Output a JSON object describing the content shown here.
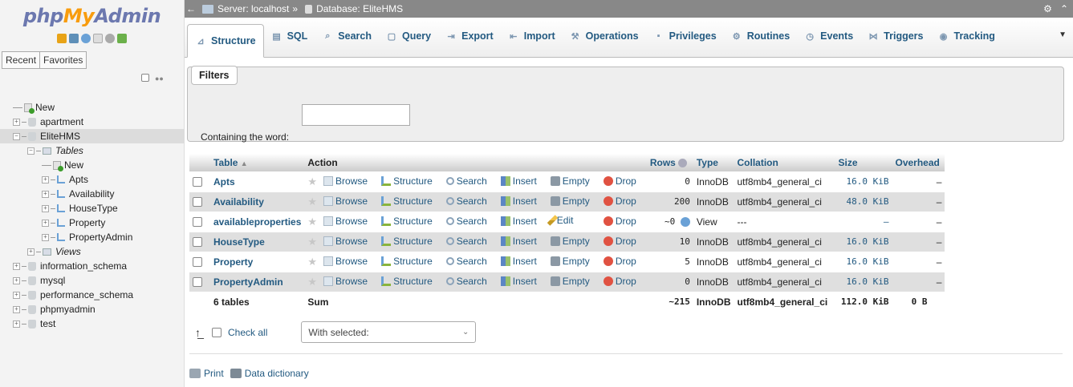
{
  "sidebar": {
    "logo": {
      "php": "php",
      "my": "My",
      "admin": "Admin"
    },
    "recent_label": "Recent",
    "favorites_label": "Favorites",
    "tree": [
      {
        "label": "New",
        "level": 0,
        "kind": "new"
      },
      {
        "label": "apartment",
        "level": 0,
        "kind": "db"
      },
      {
        "label": "EliteHMS",
        "level": 0,
        "kind": "db",
        "selected": true
      },
      {
        "label": "Tables",
        "level": 1,
        "kind": "folder",
        "italic": true
      },
      {
        "label": "New",
        "level": 2,
        "kind": "new"
      },
      {
        "label": "Apts",
        "level": 2,
        "kind": "table"
      },
      {
        "label": "Availability",
        "level": 2,
        "kind": "table"
      },
      {
        "label": "HouseType",
        "level": 2,
        "kind": "table"
      },
      {
        "label": "Property",
        "level": 2,
        "kind": "table"
      },
      {
        "label": "PropertyAdmin",
        "level": 2,
        "kind": "table"
      },
      {
        "label": "Views",
        "level": 1,
        "kind": "folder",
        "italic": true
      },
      {
        "label": "information_schema",
        "level": 0,
        "kind": "db"
      },
      {
        "label": "mysql",
        "level": 0,
        "kind": "db"
      },
      {
        "label": "performance_schema",
        "level": 0,
        "kind": "db"
      },
      {
        "label": "phpmyadmin",
        "level": 0,
        "kind": "db"
      },
      {
        "label": "test",
        "level": 0,
        "kind": "db"
      }
    ]
  },
  "topbar": {
    "server": "Server: localhost",
    "separator": "»",
    "database": "Database: EliteHMS"
  },
  "tabs": [
    {
      "label": "Structure",
      "icon": "structure-icon",
      "active": true
    },
    {
      "label": "SQL",
      "icon": "sql-icon"
    },
    {
      "label": "Search",
      "icon": "search-icon"
    },
    {
      "label": "Query",
      "icon": "query-icon"
    },
    {
      "label": "Export",
      "icon": "export-icon"
    },
    {
      "label": "Import",
      "icon": "import-icon"
    },
    {
      "label": "Operations",
      "icon": "operations-icon"
    },
    {
      "label": "Privileges",
      "icon": "privileges-icon"
    },
    {
      "label": "Routines",
      "icon": "routines-icon"
    },
    {
      "label": "Events",
      "icon": "events-icon"
    },
    {
      "label": "Triggers",
      "icon": "triggers-icon"
    },
    {
      "label": "Tracking",
      "icon": "tracking-icon"
    }
  ],
  "filters": {
    "legend": "Filters",
    "label": "Containing the word:",
    "value": ""
  },
  "table": {
    "headers": {
      "table": "Table",
      "action": "Action",
      "rows": "Rows",
      "type": "Type",
      "collation": "Collation",
      "size": "Size",
      "overhead": "Overhead"
    },
    "actions": {
      "browse": "Browse",
      "structure": "Structure",
      "search": "Search",
      "insert": "Insert",
      "empty": "Empty",
      "edit": "Edit",
      "drop": "Drop"
    },
    "rows": [
      {
        "name": "Apts",
        "rows": "0",
        "type": "InnoDB",
        "collation": "utf8mb4_general_ci",
        "size": "16.0 KiB",
        "overhead": "–"
      },
      {
        "name": "Availability",
        "rows": "200",
        "type": "InnoDB",
        "collation": "utf8mb4_general_ci",
        "size": "48.0 KiB",
        "overhead": "–"
      },
      {
        "name": "availableproperties",
        "rows": "~0",
        "type": "View",
        "collation": "---",
        "size": "–",
        "overhead": "–",
        "view": true
      },
      {
        "name": "HouseType",
        "rows": "10",
        "type": "InnoDB",
        "collation": "utf8mb4_general_ci",
        "size": "16.0 KiB",
        "overhead": "–"
      },
      {
        "name": "Property",
        "rows": "5",
        "type": "InnoDB",
        "collation": "utf8mb4_general_ci",
        "size": "16.0 KiB",
        "overhead": "–"
      },
      {
        "name": "PropertyAdmin",
        "rows": "0",
        "type": "InnoDB",
        "collation": "utf8mb4_general_ci",
        "size": "16.0 KiB",
        "overhead": "–"
      }
    ],
    "summary": {
      "count": "6 tables",
      "label": "Sum",
      "rows": "~215",
      "type": "InnoDB",
      "collation": "utf8mb4_general_ci",
      "size": "112.0 KiB",
      "overhead": "0 B"
    }
  },
  "bottom": {
    "check_all": "Check all",
    "with_selected": "With selected:",
    "print": "Print",
    "data_dictionary": "Data dictionary"
  }
}
